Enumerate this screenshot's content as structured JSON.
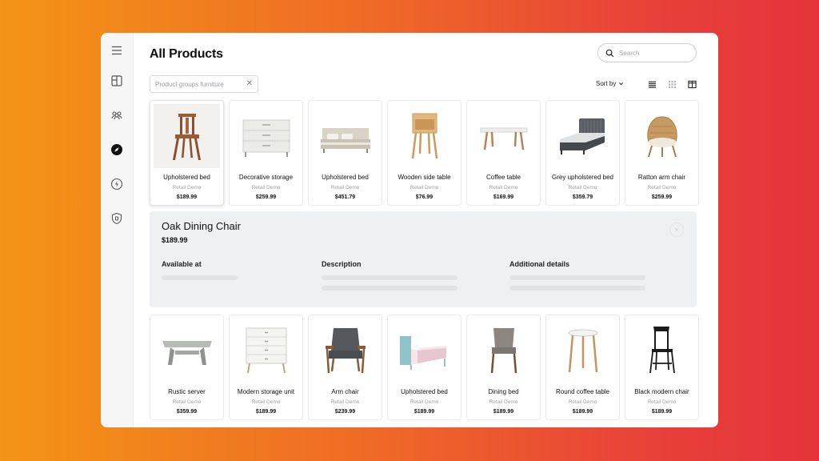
{
  "page": {
    "title": "All Products"
  },
  "search": {
    "placeholder": "Search",
    "value": ""
  },
  "filter": {
    "label": "Product groups furniture",
    "clear_icon": "close-icon"
  },
  "toolbar": {
    "sort_label": "Sort by",
    "views": [
      "list-view-icon",
      "grid-view-icon",
      "split-view-icon"
    ]
  },
  "sidebar": {
    "items": [
      {
        "icon": "hamburger-menu-icon"
      },
      {
        "icon": "dashboard-icon"
      },
      {
        "icon": "users-icon"
      },
      {
        "icon": "compass-icon",
        "active": true
      },
      {
        "icon": "lightning-icon"
      },
      {
        "icon": "shield-icon"
      }
    ]
  },
  "products_top": [
    {
      "name": "Upholstered bed",
      "vendor": "Retail Demo",
      "price": "$189.99",
      "image": "chair-icon"
    },
    {
      "name": "Decorative storage",
      "vendor": "Retail Demo",
      "price": "$259.99",
      "image": "dresser-icon"
    },
    {
      "name": "Upholstered bed",
      "vendor": "Retail Demo",
      "price": "$451.79",
      "image": "bed-icon"
    },
    {
      "name": "Wooden side table",
      "vendor": "Retail Demo",
      "price": "$76.99",
      "image": "side-table-icon"
    },
    {
      "name": "Coffee table",
      "vendor": "Retail Demo",
      "price": "$169.99",
      "image": "coffee-table-icon"
    },
    {
      "name": "Grey upholstered bed",
      "vendor": "Retail Demo",
      "price": "$359.79",
      "image": "grey-bed-icon"
    },
    {
      "name": "Ratton arm chair",
      "vendor": "Retail Demo",
      "price": "$259.99",
      "image": "rattan-chair-icon"
    }
  ],
  "detail": {
    "title": "Oak Dining Chair",
    "price": "$189.99",
    "available_label": "Available at",
    "description_label": "Description",
    "additional_label": "Additional details"
  },
  "products_bottom": [
    {
      "name": "Rustic server",
      "vendor": "Retail Demo",
      "price": "$359.99",
      "image": "bench-icon"
    },
    {
      "name": "Modern storage unit",
      "vendor": "Retail Demo",
      "price": "$189.99",
      "image": "white-dresser-icon"
    },
    {
      "name": "Arm chair",
      "vendor": "Retail Demo",
      "price": "$239.99",
      "image": "armchair-icon"
    },
    {
      "name": "Upholstered bed",
      "vendor": "Retail Demo",
      "price": "$189.99",
      "image": "teal-bed-icon"
    },
    {
      "name": "Dining bed",
      "vendor": "Retail Demo",
      "price": "$189.99",
      "image": "dining-chair-icon"
    },
    {
      "name": "Round coffee table",
      "vendor": "Retail Demo",
      "price": "$189.99",
      "image": "round-table-icon"
    },
    {
      "name": "Black modern chair",
      "vendor": "Retail Demo",
      "price": "$189.99",
      "image": "black-chair-icon"
    }
  ]
}
